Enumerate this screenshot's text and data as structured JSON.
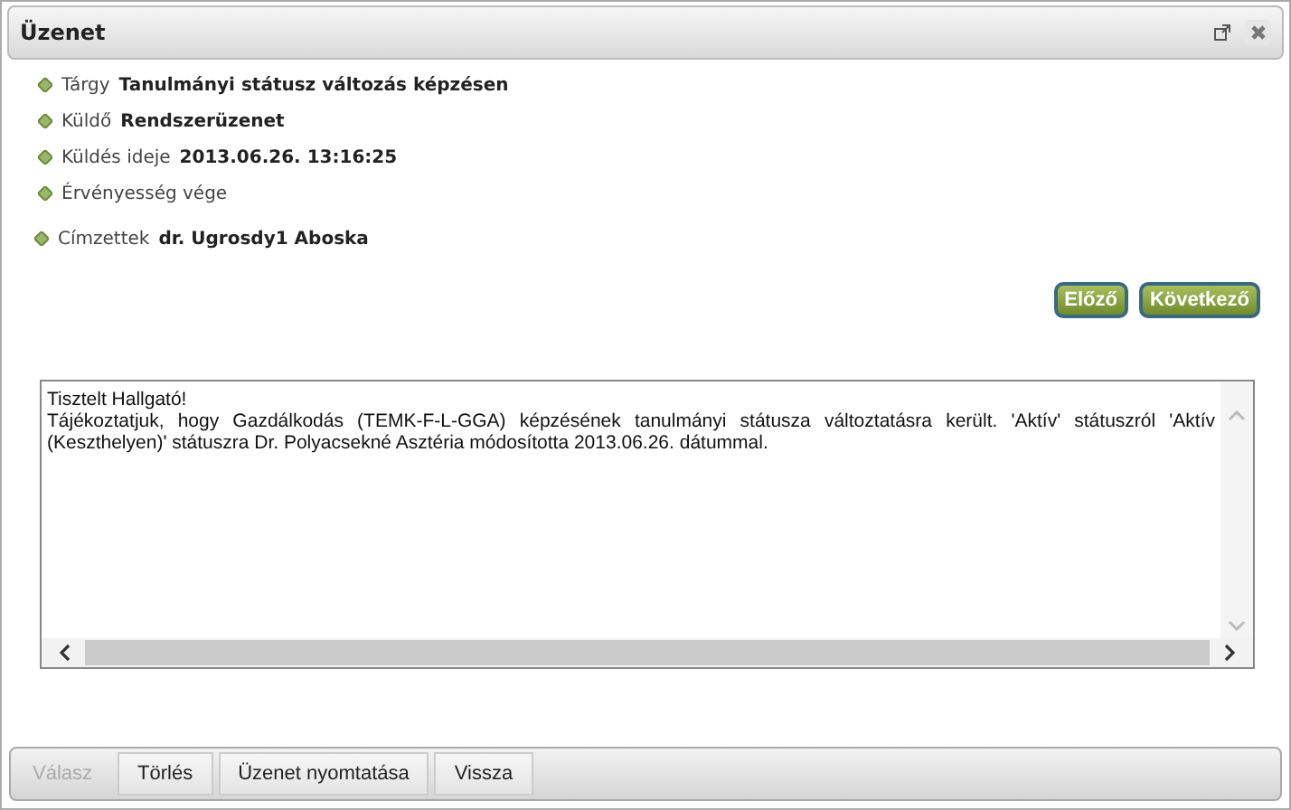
{
  "window": {
    "title": "Üzenet"
  },
  "fields": [
    {
      "label": "Tárgy",
      "value": "Tanulmányi státusz változás képzésen"
    },
    {
      "label": "Küldő",
      "value": "Rendszerüzenet"
    },
    {
      "label": "Küldés ideje",
      "value": "2013.06.26. 13:16:25"
    },
    {
      "label": "Érvényesség vége"
    },
    {
      "label": "Címzettek",
      "value": "dr. Ugrosdy1 Aboska"
    }
  ],
  "nav_buttons": [
    "Előző",
    "Következő"
  ],
  "message": [
    "Tisztelt Hallgató!",
    "Tájékoztatjuk, hogy Gazdálkodás (TEMK-F-L-GGA) képzésének tanulmányi státusza változtatásra került. 'Aktív' státuszról 'Aktív (Keszthelyen)' státuszra Dr. Polyacsekné Asztéria módosította 2013.06.26. dátummal."
  ],
  "toolbar": [
    {
      "label": "Válasz",
      "disabled": true
    },
    {
      "label": "Törlés",
      "disabled": false
    },
    {
      "label": "Üzenet nyomtatása",
      "disabled": false
    },
    {
      "label": "Vissza",
      "disabled": false
    }
  ]
}
